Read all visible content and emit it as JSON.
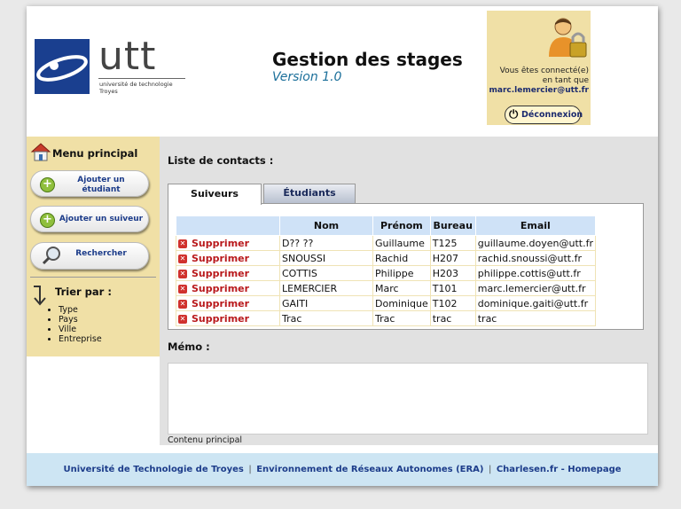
{
  "header": {
    "logo": {
      "brand": "utt",
      "subtitle_line1": "université de technologie",
      "subtitle_line2": "Troyes"
    },
    "title": "Gestion des stages",
    "version": "Version 1.0",
    "user": {
      "connected_line1": "Vous êtes connecté(e)",
      "connected_line2": "en tant que",
      "email": "marc.lemercier@utt.fr",
      "logout_label": "Déconnexion"
    }
  },
  "sidebar": {
    "menu_title": "Menu principal",
    "buttons": [
      {
        "label": "Ajouter un étudiant",
        "icon": "plus-icon"
      },
      {
        "label": "Ajouter un suiveur",
        "icon": "plus-icon"
      },
      {
        "label": "Rechercher",
        "icon": "magnifier-icon"
      }
    ],
    "sort_title": "Trier par :",
    "sort_items": [
      "Type",
      "Pays",
      "Ville",
      "Entreprise"
    ]
  },
  "main": {
    "title": "Liste de contacts :",
    "tabs": [
      {
        "label": "Suiveurs",
        "active": true
      },
      {
        "label": "Étudiants",
        "active": false
      }
    ],
    "table": {
      "columns": [
        "",
        "Nom",
        "Prénom",
        "Bureau",
        "Email"
      ],
      "delete_label": "Supprimer",
      "rows": [
        {
          "nom": "D?? ??",
          "prenom": "Guillaume",
          "bureau": "T125",
          "email": "guillaume.doyen@utt.fr"
        },
        {
          "nom": "SNOUSSI",
          "prenom": "Rachid",
          "bureau": "H207",
          "email": "rachid.snoussi@utt.fr"
        },
        {
          "nom": "COTTIS",
          "prenom": "Philippe",
          "bureau": "H203",
          "email": "philippe.cottis@utt.fr"
        },
        {
          "nom": "LEMERCIER",
          "prenom": "Marc",
          "bureau": "T101",
          "email": "marc.lemercier@utt.fr"
        },
        {
          "nom": "GAITI",
          "prenom": "Dominique",
          "bureau": "T102",
          "email": "dominique.gaiti@utt.fr"
        },
        {
          "nom": "Trac",
          "prenom": "Trac",
          "bureau": "trac",
          "email": "trac"
        }
      ]
    },
    "memo_title": "Mémo :",
    "caption": "Contenu principal"
  },
  "footer": {
    "links": [
      "Université de Technologie de Troyes",
      "Environnement de Réseaux Autonomes (ERA)",
      "Charlesen.fr - Homepage"
    ],
    "separator": "|"
  },
  "colors": {
    "sidebar_bg": "#f0e0a6",
    "main_bg": "#e1e1e1",
    "table_header_bg": "#cfe2f7",
    "footer_bg": "#cde5f3",
    "link_blue": "#1c3c8a",
    "delete_red": "#b9191c"
  }
}
